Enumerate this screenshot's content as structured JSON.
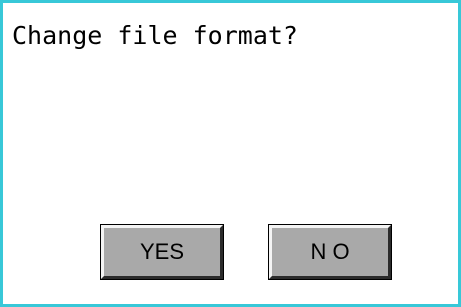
{
  "dialog": {
    "message": "Change file format?",
    "yes_label": "YES",
    "no_label": "N O"
  },
  "colors": {
    "border": "#38c8d8",
    "background": "#ffffff",
    "button_face": "#a9a9a9",
    "text": "#000000"
  }
}
